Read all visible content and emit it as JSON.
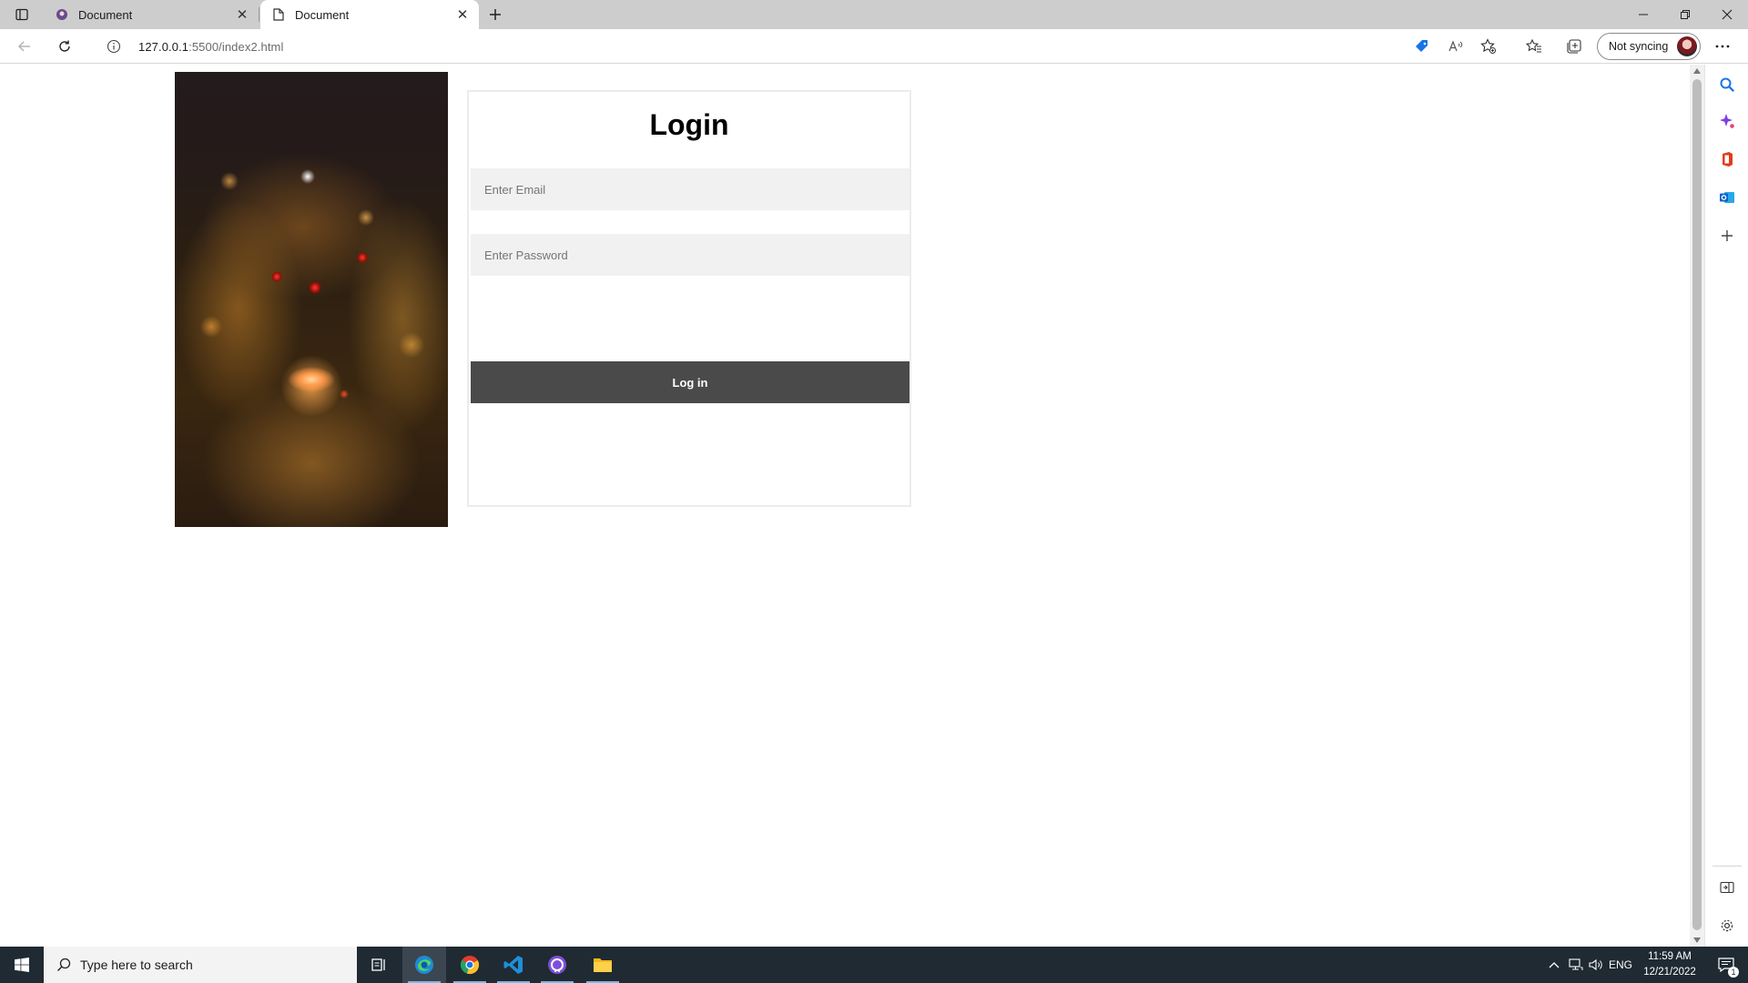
{
  "browser": {
    "tabs": [
      {
        "title": "Document",
        "active": false
      },
      {
        "title": "Document",
        "active": true
      }
    ],
    "address": {
      "url_host": "127.0.0.1",
      "url_rest": ":5500/index2.html"
    },
    "profile": {
      "label": "Not syncing"
    }
  },
  "page": {
    "login": {
      "title": "Login",
      "email_placeholder": "Enter Email",
      "password_placeholder": "Enter Password",
      "submit_label": "Log in"
    }
  },
  "taskbar": {
    "search_placeholder": "Type here to search",
    "language": "ENG",
    "time": "11:59 AM",
    "date": "12/21/2022",
    "notification_count": "1"
  },
  "colors": {
    "button_bg": "#4a4a4a",
    "input_bg": "#f1f1f1",
    "taskbar_bg": "#1f2a33",
    "tabstrip_bg": "#cdcdcd"
  }
}
